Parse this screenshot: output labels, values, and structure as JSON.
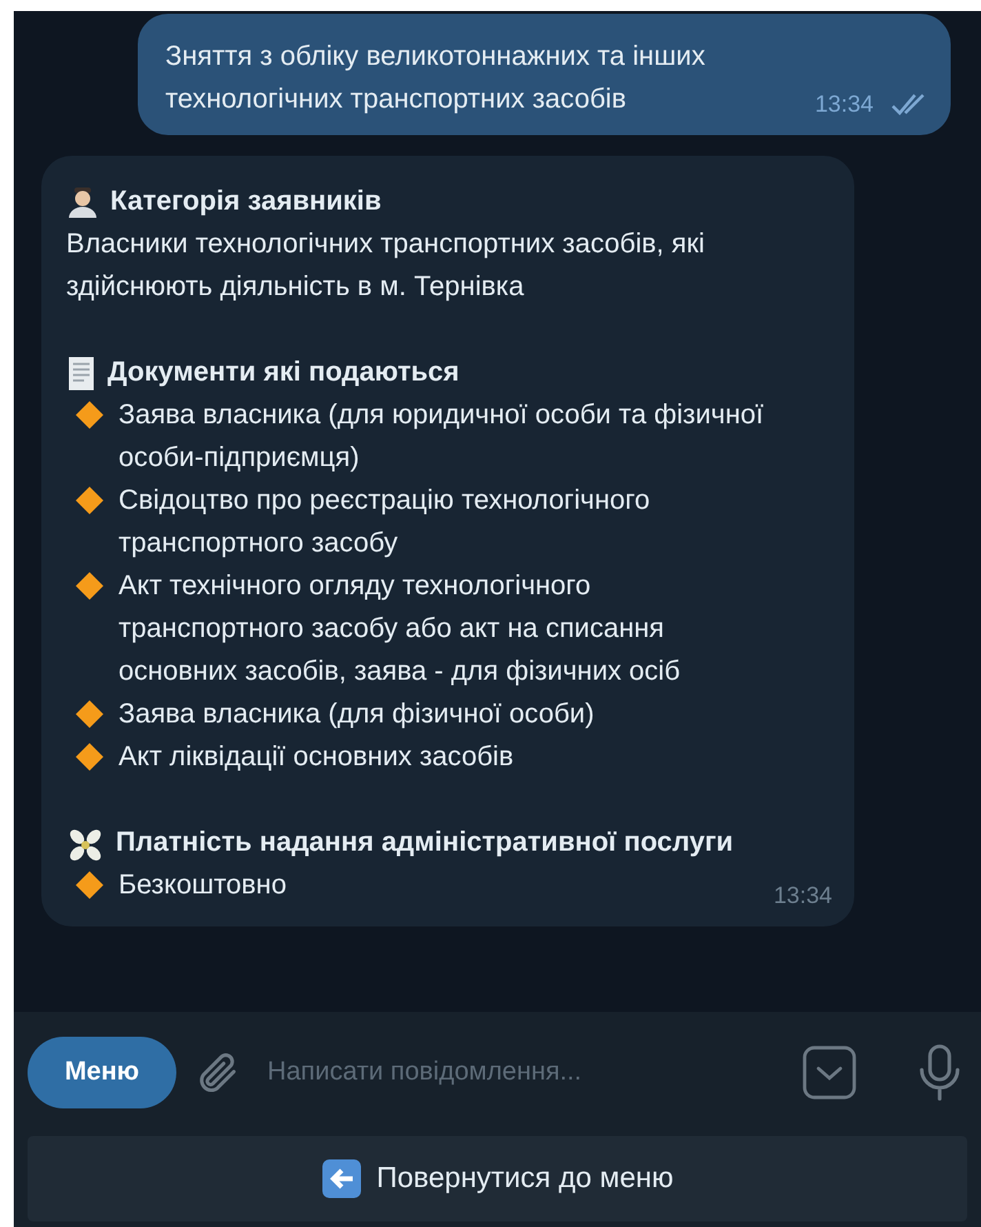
{
  "outgoing_message": {
    "text": "Зняття з обліку великотоннажних та інших технологічних транспортних засобів",
    "time": "13:34",
    "read": true
  },
  "incoming_message": {
    "time": "13:34",
    "sections": [
      {
        "title": "Категорія заявників",
        "paragraph": "Власники технологічних транспортних засобів, які здійснюють діяльність в м. Тернівка"
      },
      {
        "title": "Документи які подаються",
        "items": [
          "Заява власника (для юридичної особи та фізичної особи-підприємця)",
          "Свідоцтво про реєстрацію технологічного транспортного засобу",
          "Акт технічного огляду технологічного транспортного засобу або акт на списання основних засобів, заява - для фізичних осіб",
          "Заява власника (для фізичної особи)",
          "Акт ліквідації основних засобів"
        ]
      },
      {
        "title": "Платність надання адміністративної послуги",
        "items": [
          "Безкоштовно"
        ]
      }
    ]
  },
  "composer": {
    "menu_button": "Меню",
    "placeholder": "Написати повідомлення..."
  },
  "keyboard": [
    {
      "label": "Повернутися до меню"
    }
  ]
}
